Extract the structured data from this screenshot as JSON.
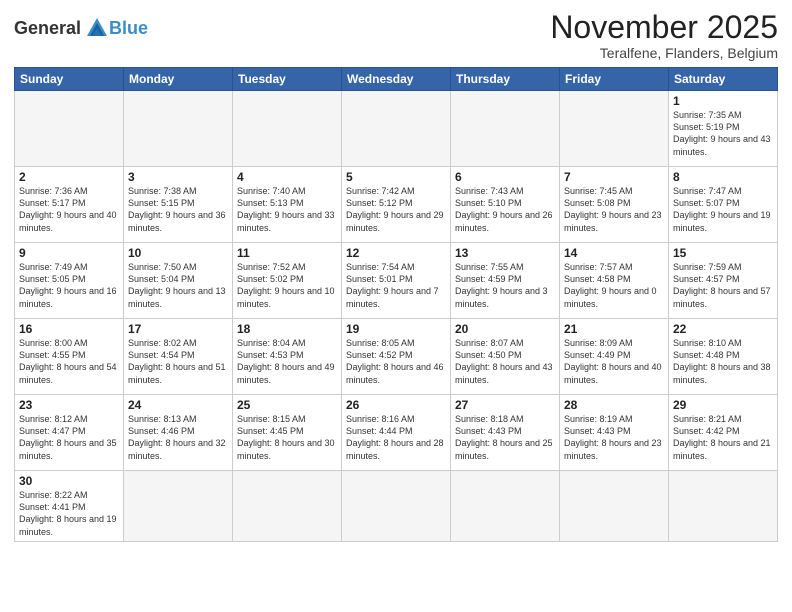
{
  "logo": {
    "text_general": "General",
    "text_blue": "Blue"
  },
  "header": {
    "month": "November 2025",
    "location": "Teralfene, Flanders, Belgium"
  },
  "weekdays": [
    "Sunday",
    "Monday",
    "Tuesday",
    "Wednesday",
    "Thursday",
    "Friday",
    "Saturday"
  ],
  "weeks": [
    [
      {
        "day": "",
        "info": ""
      },
      {
        "day": "",
        "info": ""
      },
      {
        "day": "",
        "info": ""
      },
      {
        "day": "",
        "info": ""
      },
      {
        "day": "",
        "info": ""
      },
      {
        "day": "",
        "info": ""
      },
      {
        "day": "1",
        "info": "Sunrise: 7:35 AM\nSunset: 5:19 PM\nDaylight: 9 hours\nand 43 minutes."
      }
    ],
    [
      {
        "day": "2",
        "info": "Sunrise: 7:36 AM\nSunset: 5:17 PM\nDaylight: 9 hours\nand 40 minutes."
      },
      {
        "day": "3",
        "info": "Sunrise: 7:38 AM\nSunset: 5:15 PM\nDaylight: 9 hours\nand 36 minutes."
      },
      {
        "day": "4",
        "info": "Sunrise: 7:40 AM\nSunset: 5:13 PM\nDaylight: 9 hours\nand 33 minutes."
      },
      {
        "day": "5",
        "info": "Sunrise: 7:42 AM\nSunset: 5:12 PM\nDaylight: 9 hours\nand 29 minutes."
      },
      {
        "day": "6",
        "info": "Sunrise: 7:43 AM\nSunset: 5:10 PM\nDaylight: 9 hours\nand 26 minutes."
      },
      {
        "day": "7",
        "info": "Sunrise: 7:45 AM\nSunset: 5:08 PM\nDaylight: 9 hours\nand 23 minutes."
      },
      {
        "day": "8",
        "info": "Sunrise: 7:47 AM\nSunset: 5:07 PM\nDaylight: 9 hours\nand 19 minutes."
      }
    ],
    [
      {
        "day": "9",
        "info": "Sunrise: 7:49 AM\nSunset: 5:05 PM\nDaylight: 9 hours\nand 16 minutes."
      },
      {
        "day": "10",
        "info": "Sunrise: 7:50 AM\nSunset: 5:04 PM\nDaylight: 9 hours\nand 13 minutes."
      },
      {
        "day": "11",
        "info": "Sunrise: 7:52 AM\nSunset: 5:02 PM\nDaylight: 9 hours\nand 10 minutes."
      },
      {
        "day": "12",
        "info": "Sunrise: 7:54 AM\nSunset: 5:01 PM\nDaylight: 9 hours\nand 7 minutes."
      },
      {
        "day": "13",
        "info": "Sunrise: 7:55 AM\nSunset: 4:59 PM\nDaylight: 9 hours\nand 3 minutes."
      },
      {
        "day": "14",
        "info": "Sunrise: 7:57 AM\nSunset: 4:58 PM\nDaylight: 9 hours\nand 0 minutes."
      },
      {
        "day": "15",
        "info": "Sunrise: 7:59 AM\nSunset: 4:57 PM\nDaylight: 8 hours\nand 57 minutes."
      }
    ],
    [
      {
        "day": "16",
        "info": "Sunrise: 8:00 AM\nSunset: 4:55 PM\nDaylight: 8 hours\nand 54 minutes."
      },
      {
        "day": "17",
        "info": "Sunrise: 8:02 AM\nSunset: 4:54 PM\nDaylight: 8 hours\nand 51 minutes."
      },
      {
        "day": "18",
        "info": "Sunrise: 8:04 AM\nSunset: 4:53 PM\nDaylight: 8 hours\nand 49 minutes."
      },
      {
        "day": "19",
        "info": "Sunrise: 8:05 AM\nSunset: 4:52 PM\nDaylight: 8 hours\nand 46 minutes."
      },
      {
        "day": "20",
        "info": "Sunrise: 8:07 AM\nSunset: 4:50 PM\nDaylight: 8 hours\nand 43 minutes."
      },
      {
        "day": "21",
        "info": "Sunrise: 8:09 AM\nSunset: 4:49 PM\nDaylight: 8 hours\nand 40 minutes."
      },
      {
        "day": "22",
        "info": "Sunrise: 8:10 AM\nSunset: 4:48 PM\nDaylight: 8 hours\nand 38 minutes."
      }
    ],
    [
      {
        "day": "23",
        "info": "Sunrise: 8:12 AM\nSunset: 4:47 PM\nDaylight: 8 hours\nand 35 minutes."
      },
      {
        "day": "24",
        "info": "Sunrise: 8:13 AM\nSunset: 4:46 PM\nDaylight: 8 hours\nand 32 minutes."
      },
      {
        "day": "25",
        "info": "Sunrise: 8:15 AM\nSunset: 4:45 PM\nDaylight: 8 hours\nand 30 minutes."
      },
      {
        "day": "26",
        "info": "Sunrise: 8:16 AM\nSunset: 4:44 PM\nDaylight: 8 hours\nand 28 minutes."
      },
      {
        "day": "27",
        "info": "Sunrise: 8:18 AM\nSunset: 4:43 PM\nDaylight: 8 hours\nand 25 minutes."
      },
      {
        "day": "28",
        "info": "Sunrise: 8:19 AM\nSunset: 4:43 PM\nDaylight: 8 hours\nand 23 minutes."
      },
      {
        "day": "29",
        "info": "Sunrise: 8:21 AM\nSunset: 4:42 PM\nDaylight: 8 hours\nand 21 minutes."
      }
    ],
    [
      {
        "day": "30",
        "info": "Sunrise: 8:22 AM\nSunset: 4:41 PM\nDaylight: 8 hours\nand 19 minutes."
      },
      {
        "day": "",
        "info": ""
      },
      {
        "day": "",
        "info": ""
      },
      {
        "day": "",
        "info": ""
      },
      {
        "day": "",
        "info": ""
      },
      {
        "day": "",
        "info": ""
      },
      {
        "day": "",
        "info": ""
      }
    ]
  ]
}
